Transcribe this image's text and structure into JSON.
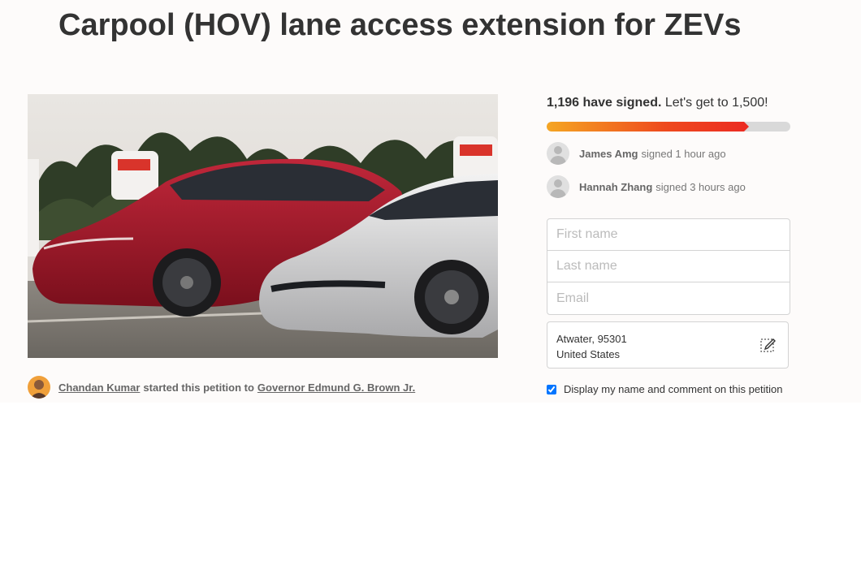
{
  "petition": {
    "title": "Carpool (HOV) lane access extension for ZEVs",
    "starter": {
      "name": "Chandan Kumar",
      "verb": "started this petition to",
      "target": "Governor Edmund G. Brown Jr."
    }
  },
  "signatures": {
    "count_text": "1,196 have signed.",
    "goal_text": "Let's get to 1,500!",
    "signed": 1196,
    "goal": 1500,
    "progress_fraction": 0.81,
    "progress_colors": [
      "#f5a623",
      "#ec2c22"
    ],
    "recent": [
      {
        "name": "James Amg",
        "when": "signed 1 hour ago"
      },
      {
        "name": "Hannah Zhang",
        "when": "signed 3 hours ago"
      }
    ]
  },
  "form": {
    "first_name_placeholder": "First name",
    "last_name_placeholder": "Last name",
    "email_placeholder": "Email",
    "address_line1": "Atwater, 95301",
    "address_line2": "United States",
    "display_checkbox_label": "Display my name and comment on this petition",
    "display_checked": true
  },
  "icons": {
    "edit": "edit-pencil-icon",
    "avatar_placeholder": "person-silhouette-icon"
  }
}
